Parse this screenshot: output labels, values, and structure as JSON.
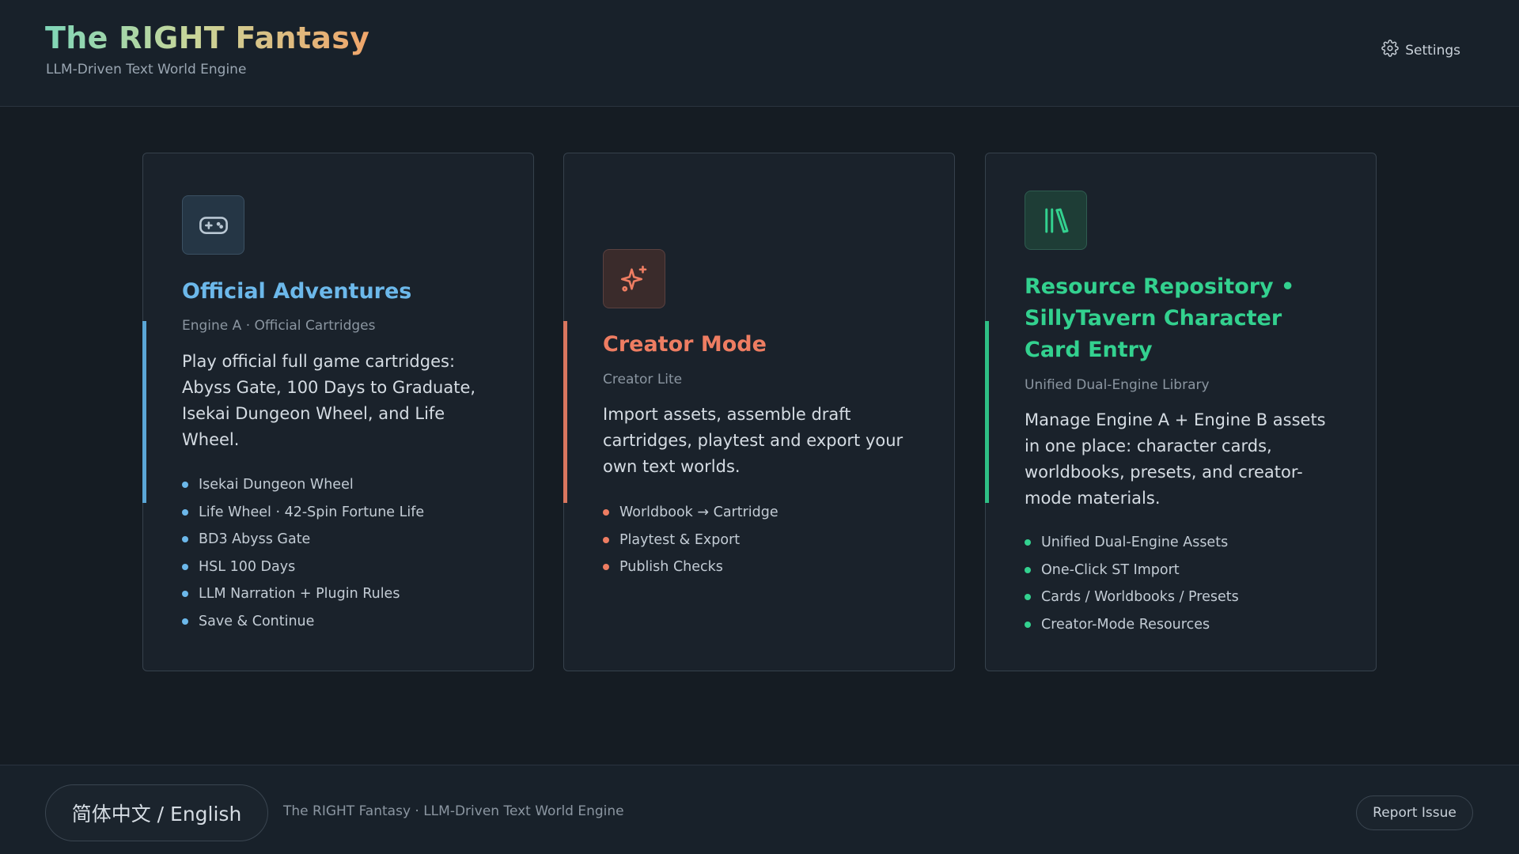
{
  "header": {
    "title": "The RIGHT Fantasy",
    "subtitle": "LLM-Driven Text World Engine",
    "settings_label": "Settings",
    "settings_icon": "gear-icon"
  },
  "colors": {
    "background": "#151c23",
    "card_blue": "#6cb8ea",
    "card_coral": "#ee7d62",
    "card_green": "#33d18f"
  },
  "cards": [
    {
      "icon": "gamepad-icon",
      "title": "Official Adventures",
      "subtitle": "Engine A · Official Cartridges",
      "description": "Play official full game cartridges: Abyss Gate, 100 Days to Graduate, Isekai Dungeon Wheel, and Life Wheel.",
      "features": [
        "Isekai Dungeon Wheel",
        "Life Wheel · 42-Spin Fortune Life",
        "BD3 Abyss Gate",
        "HSL 100 Days",
        "LLM Narration + Plugin Rules",
        "Save & Continue"
      ]
    },
    {
      "icon": "sparkles-icon",
      "title": "Creator Mode",
      "subtitle": "Creator Lite",
      "description": "Import assets, assemble draft cartridges, playtest and export your own text worlds.",
      "features": [
        "Worldbook → Cartridge",
        "Playtest & Export",
        "Publish Checks"
      ]
    },
    {
      "icon": "library-icon",
      "title": "Resource Repository • SillyTavern Character Card Entry",
      "subtitle": "Unified Dual-Engine Library",
      "description": "Manage Engine A + Engine B assets in one place: character cards, worldbooks, presets, and creator-mode materials.",
      "features": [
        "Unified Dual-Engine Assets",
        "One-Click ST Import",
        "Cards / Worldbooks / Presets",
        "Creator-Mode Resources"
      ]
    }
  ],
  "footer": {
    "language_label": "简体中文 / English",
    "tagline": "The RIGHT Fantasy · LLM-Driven Text World Engine",
    "report_label": "Report Issue"
  }
}
